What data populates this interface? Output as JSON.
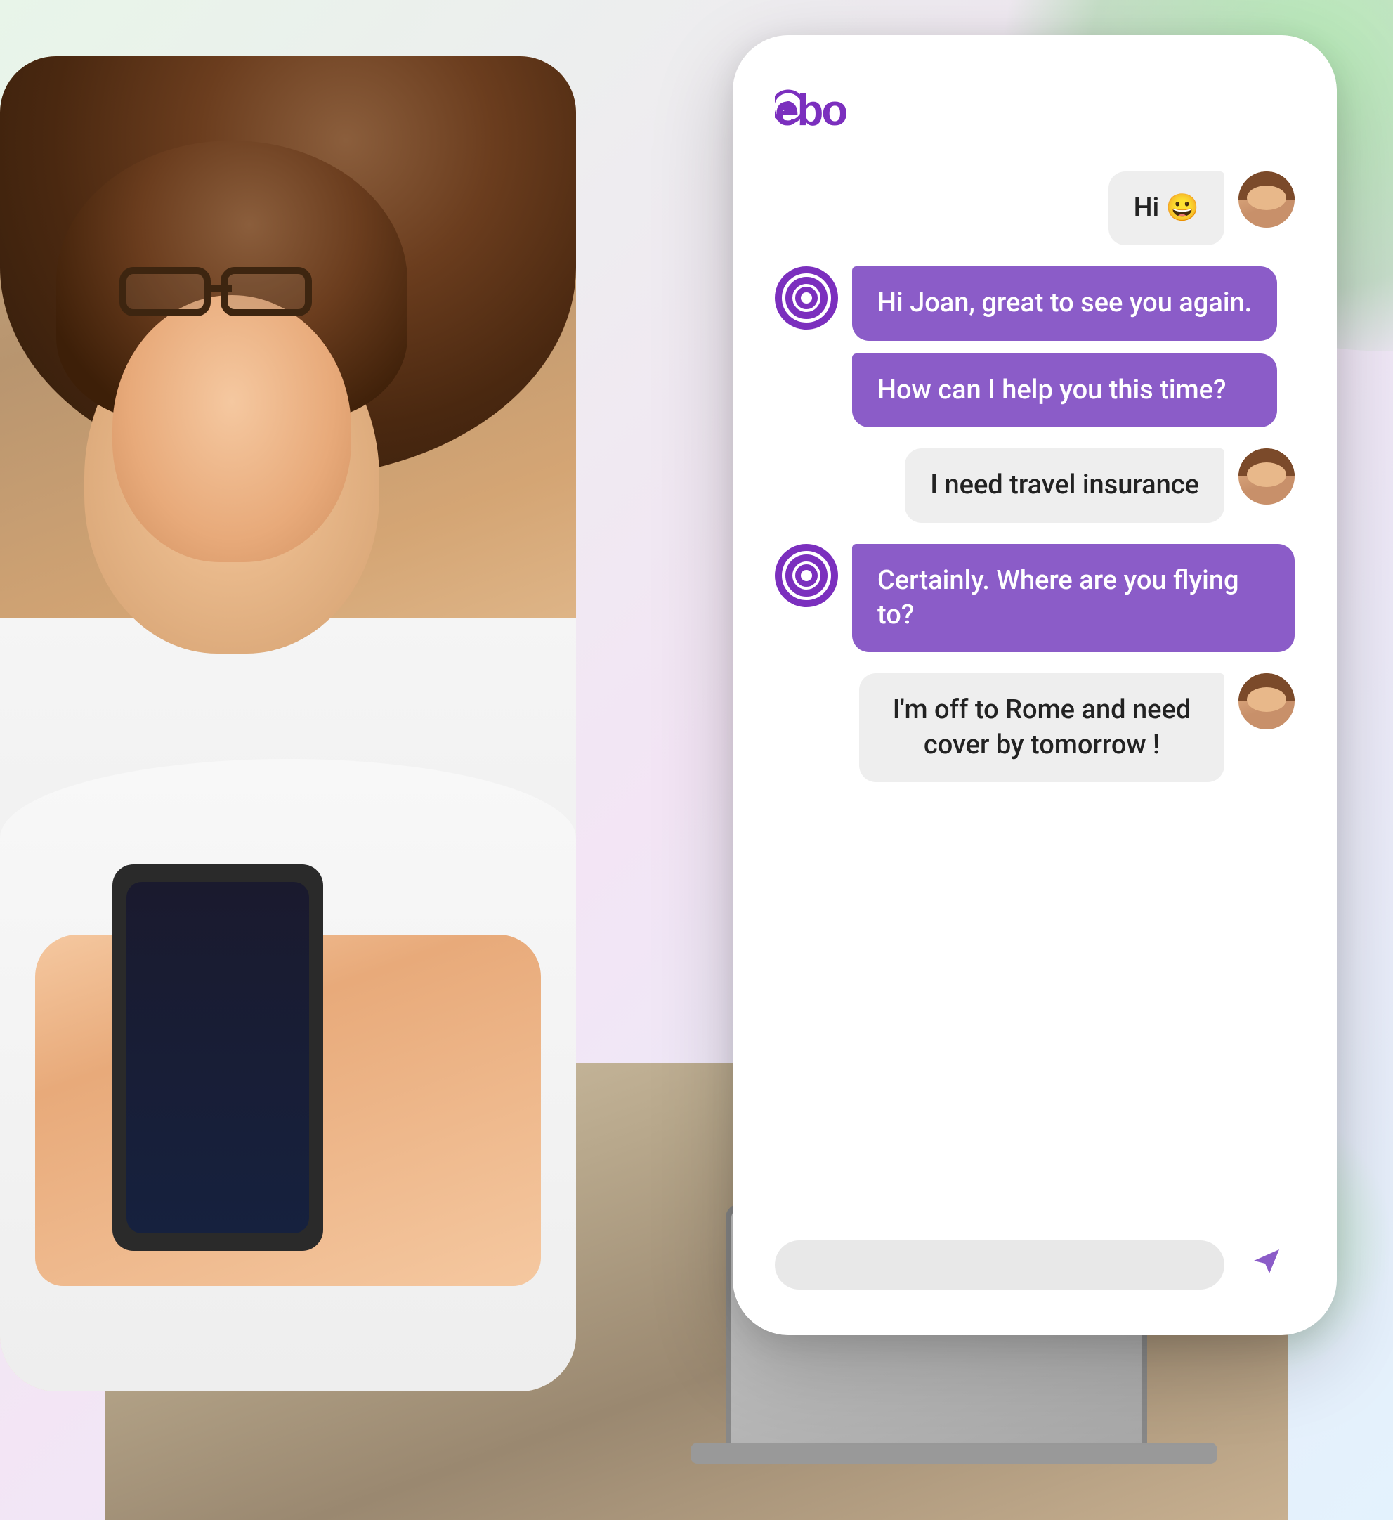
{
  "app": {
    "logo": "ebo",
    "brand_color": "#7B2FBE"
  },
  "scene": {
    "background_color": "#f0eff5"
  },
  "chat": {
    "messages": [
      {
        "id": "msg-1",
        "sender": "user",
        "text": "Hi 😀",
        "avatar_type": "user"
      },
      {
        "id": "msg-2",
        "sender": "bot",
        "text": "Hi Joan, great to see you again.",
        "avatar_type": "bot"
      },
      {
        "id": "msg-3",
        "sender": "bot",
        "text": "How can I help you this time?",
        "avatar_type": "bot"
      },
      {
        "id": "msg-4",
        "sender": "user",
        "text": "I need travel insurance",
        "avatar_type": "user"
      },
      {
        "id": "msg-5",
        "sender": "bot",
        "text": "Certainly. Where are you flying to?",
        "avatar_type": "bot"
      },
      {
        "id": "msg-6",
        "sender": "user",
        "text": "I'm off to Rome and need cover by tomorrow !",
        "avatar_type": "user"
      }
    ],
    "input": {
      "placeholder": "",
      "value": ""
    },
    "send_button_label": "send"
  }
}
